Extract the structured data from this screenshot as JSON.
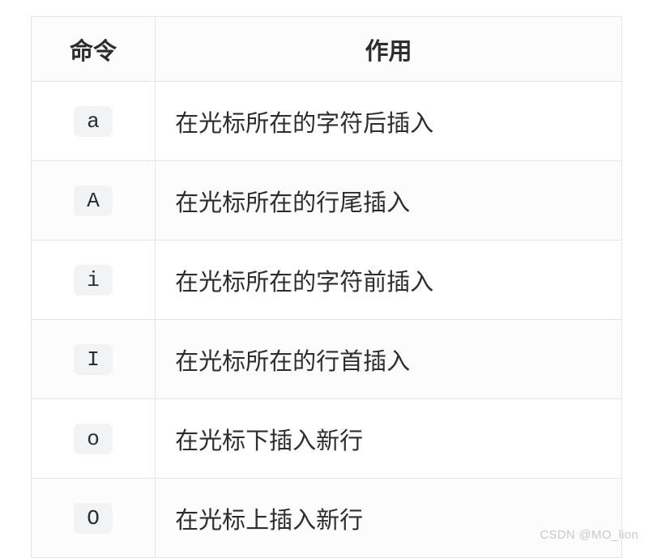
{
  "table": {
    "headers": {
      "command": "命令",
      "effect": "作用"
    },
    "rows": [
      {
        "command": "a",
        "effect": "在光标所在的字符后插入"
      },
      {
        "command": "A",
        "effect": "在光标所在的行尾插入"
      },
      {
        "command": "i",
        "effect": "在光标所在的字符前插入"
      },
      {
        "command": "I",
        "effect": "在光标所在的行首插入"
      },
      {
        "command": "o",
        "effect": "在光标下插入新行"
      },
      {
        "command": "O",
        "effect": "在光标上插入新行"
      }
    ]
  },
  "watermark": "CSDN @MO_lion"
}
